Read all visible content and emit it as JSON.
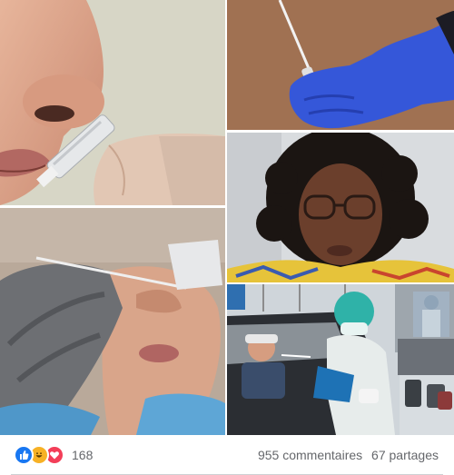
{
  "post": {
    "photos": [
      {
        "name": "nasal-swab-closeup"
      },
      {
        "name": "swab-in-gloved-hand"
      },
      {
        "name": "woman-with-glasses-video"
      },
      {
        "name": "nasal-test-side-view"
      },
      {
        "name": "drive-through-testing"
      }
    ],
    "reactions": {
      "icons": [
        "like-icon",
        "haha-icon",
        "love-icon"
      ],
      "colors": {
        "like": "#1877f2",
        "haha": "#f7b125",
        "love": "#f33e58"
      },
      "count": "168"
    },
    "comments_label": "955 commentaires",
    "shares_label": "67 partages"
  }
}
